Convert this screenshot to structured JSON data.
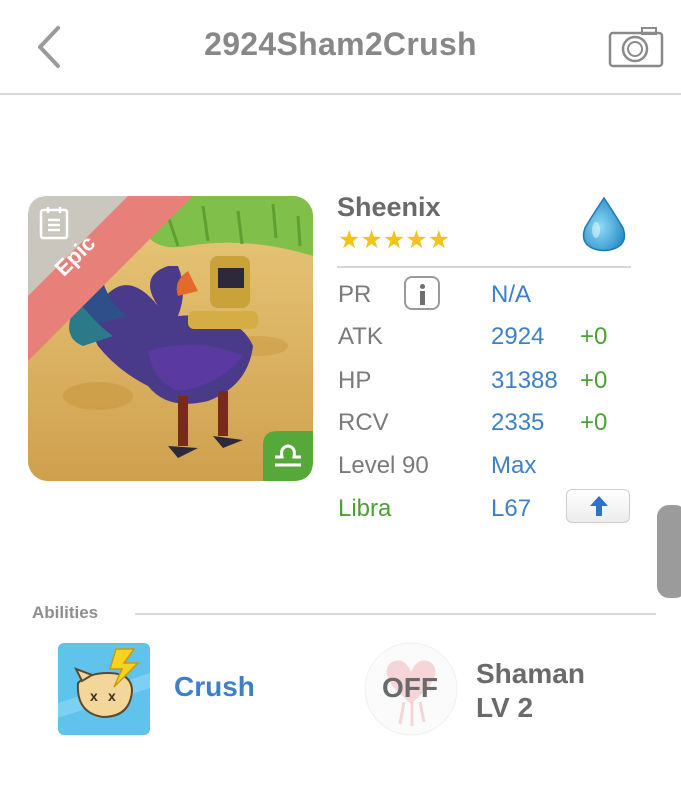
{
  "header": {
    "title": "2924Sham2Crush",
    "back_icon": "chevron-left-icon",
    "camera_icon": "camera-icon"
  },
  "monster": {
    "name": "Sheenix",
    "stars": "★★★★★",
    "star_count": 5,
    "rarity": "Epic",
    "element_icon": "water-drop-icon",
    "zodiac_icon": "libra-icon"
  },
  "stats": {
    "pr_label": "PR",
    "pr_value": "N/A",
    "atk_label": "ATK",
    "atk_value": "2924",
    "atk_bonus": "+0",
    "hp_label": "HP",
    "hp_value": "31388",
    "hp_bonus": "+0",
    "rcv_label": "RCV",
    "rcv_value": "2335",
    "rcv_bonus": "+0",
    "level_label": "Level 90",
    "level_value": "Max",
    "sign_label": "Libra",
    "sign_value": "L67"
  },
  "abilities": {
    "section_label": "Abilities",
    "skill_name": "Crush",
    "leader_state": "OFF",
    "leader_name_line1": "Shaman",
    "leader_name_line2": "LV 2"
  },
  "colors": {
    "value_blue": "#3f7fc8",
    "bonus_green": "#4aa135",
    "star_gold": "#f4c318",
    "epic_ribbon": "#e8807a"
  }
}
